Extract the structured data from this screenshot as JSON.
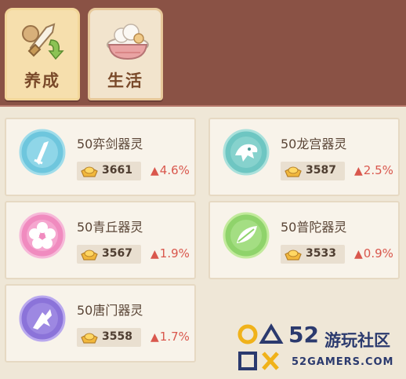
{
  "tabs": [
    {
      "label": "养成",
      "icon": "sword-upgrade-icon",
      "active": true
    },
    {
      "label": "生活",
      "icon": "food-bowl-icon",
      "active": false
    }
  ],
  "colors": {
    "header_bg": "#8a5245",
    "page_bg": "#efe7d7",
    "increase": "#d9574d",
    "cyan_emblem": "#6ec6dd",
    "pink_emblem": "#f08bbf",
    "green_emblem": "#8fd36b",
    "purple_emblem": "#8b73d9"
  },
  "cards": [
    {
      "title": "50弈剑器灵",
      "price": "3661",
      "change": "4.6%",
      "emblem": "sword-emblem-icon"
    },
    {
      "title": "50龙宫器灵",
      "price": "3587",
      "change": "2.5%",
      "emblem": "dragon-emblem-icon"
    },
    {
      "title": "50青丘器灵",
      "price": "3567",
      "change": "1.9%",
      "emblem": "flower-emblem-icon"
    },
    {
      "title": "50普陀器灵",
      "price": "3533",
      "change": "0.9%",
      "emblem": "leaf-emblem-icon"
    },
    {
      "title": "50唐门器灵",
      "price": "3558",
      "change": "1.7%",
      "emblem": "claw-emblem-icon"
    }
  ],
  "watermark": {
    "number": "52",
    "name": "游玩社区",
    "site": "52GAMERS.COM"
  }
}
